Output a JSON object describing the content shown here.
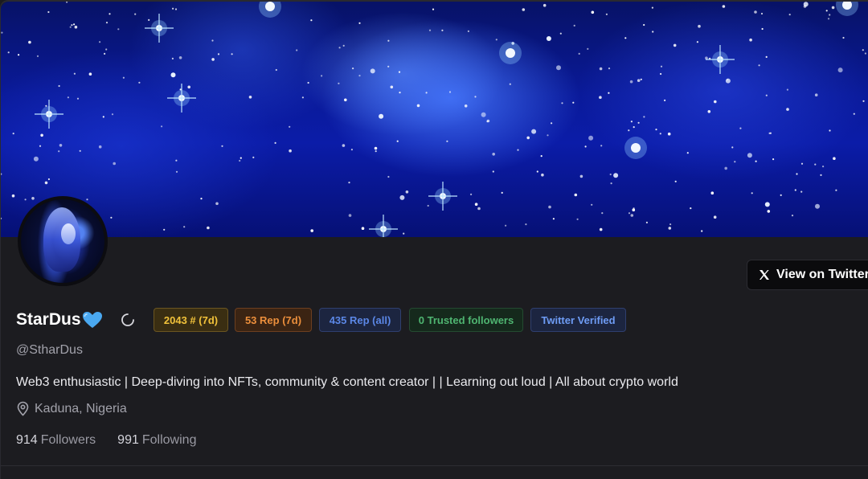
{
  "profile": {
    "name": "StarDus",
    "name_emoji_icon": "blue-heart-icon",
    "handle": "@StharDus",
    "bio": "Web3 enthusiastic | Deep-diving into NFTs, community & content creator | | Learning out loud | All about crypto world",
    "location": "Kaduna, Nigeria",
    "followers_count": "914",
    "followers_label": "Followers",
    "following_count": "991",
    "following_label": "Following"
  },
  "badges": [
    {
      "label": "2043 # (7d)",
      "color": "#f1c23a"
    },
    {
      "label": "53 Rep (7d)",
      "color": "#ec8f3c"
    },
    {
      "label": "435 Rep (all)",
      "color": "#5b87e6"
    },
    {
      "label": "0 Trusted followers",
      "color": "#4fb571"
    },
    {
      "label": "Twitter Verified",
      "color": "#6e9cf5"
    }
  ],
  "actions": {
    "view_twitter_label": "View on Twitter"
  },
  "colors": {
    "background": "#1c1c20",
    "banner_blue": "#0b1ca8",
    "accent_white": "#ffffff"
  }
}
